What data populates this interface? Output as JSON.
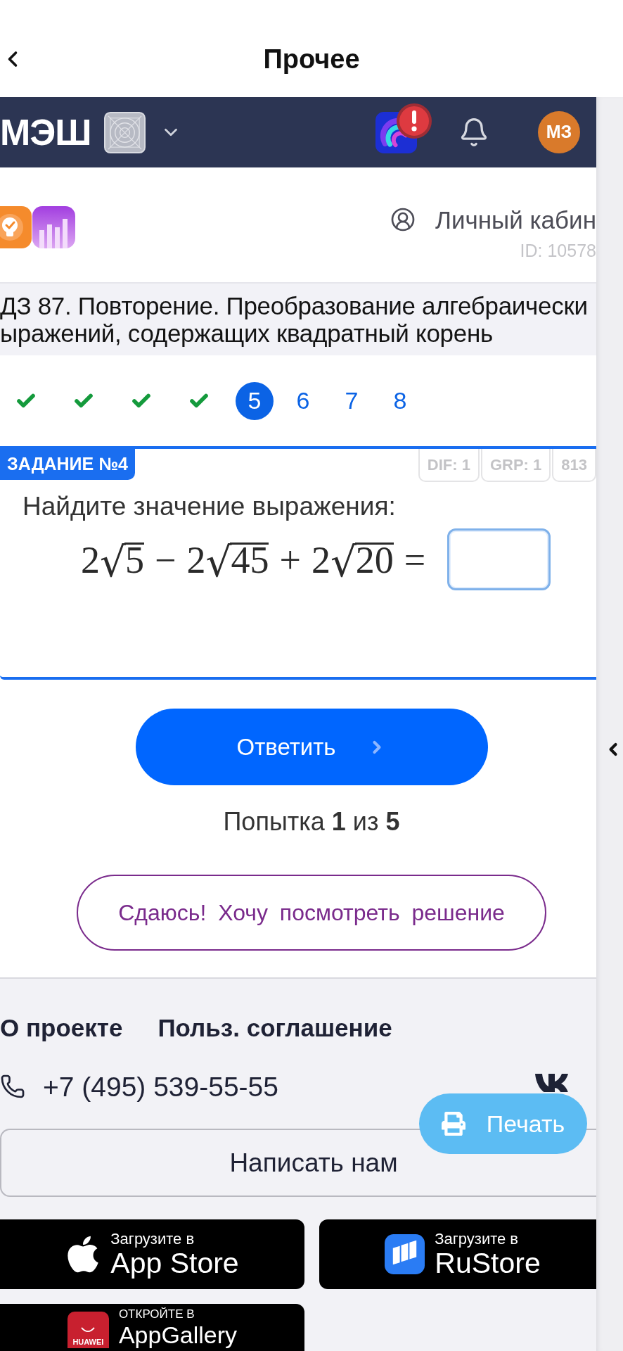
{
  "top_bar": {
    "title": "Прочее"
  },
  "navbar": {
    "logo": "МЭШ",
    "notification_alert": true,
    "avatar_initials": "МЗ"
  },
  "profile": {
    "account_label": "Личный кабин",
    "account_id": "ID: 10578"
  },
  "assignment": {
    "title_lines": [
      "ДЗ 87. Повторение. Преобразование алгебраически",
      "ыражений, содержащих квадратный корень"
    ]
  },
  "steps": [
    {
      "done": true,
      "selected": false
    },
    {
      "done": true,
      "selected": false
    },
    {
      "done": true,
      "selected": false
    },
    {
      "done": true,
      "selected": false
    },
    {
      "label": "5",
      "done": false,
      "selected": true
    },
    {
      "label": "6",
      "done": false,
      "selected": false
    },
    {
      "label": "7",
      "done": false,
      "selected": false
    },
    {
      "label": "8",
      "done": false,
      "selected": false
    }
  ],
  "task": {
    "badge": "ЗАДАНИЕ №4",
    "tags": [
      "DIF: 1",
      "GRP: 1",
      "813"
    ],
    "prompt": "Найдите значение выражения:",
    "expression": [
      {
        "kind": "number",
        "text": "2"
      },
      {
        "kind": "sqrt",
        "radical": "√",
        "text": "5"
      },
      {
        "kind": "operator",
        "text": "−"
      },
      {
        "kind": "number",
        "text": "2"
      },
      {
        "kind": "sqrt",
        "radical": "√",
        "text": "45"
      },
      {
        "kind": "operator",
        "text": "+"
      },
      {
        "kind": "number",
        "text": "2"
      },
      {
        "kind": "sqrt",
        "radical": "√",
        "text": "20"
      },
      {
        "kind": "operator",
        "text": "="
      }
    ],
    "answer": {
      "focused": true
    }
  },
  "submit_button": {
    "label": "Ответить"
  },
  "attempts": {
    "text": "Попытка **1** из **5**"
  },
  "give_up_button": {
    "label": "Сдаюсь! Хочу посмотреть решение"
  },
  "footer": {
    "links": [
      "О проекте",
      "Польз. соглашение"
    ],
    "phone": "+7 (495) 539-55-55",
    "contact_button": "Написать нам",
    "stores": [
      {
        "kind": "apple",
        "caption": "Загрузите в",
        "name": "App Store"
      },
      {
        "kind": "rustore",
        "caption": "Загрузите в",
        "name": "RuStore"
      },
      {
        "kind": "huawei",
        "caption": "ОТКРОЙТЕ В",
        "name": "AppGallery",
        "logo_text": "HUAWEI"
      }
    ]
  },
  "print_button": {
    "label": "Печать"
  }
}
